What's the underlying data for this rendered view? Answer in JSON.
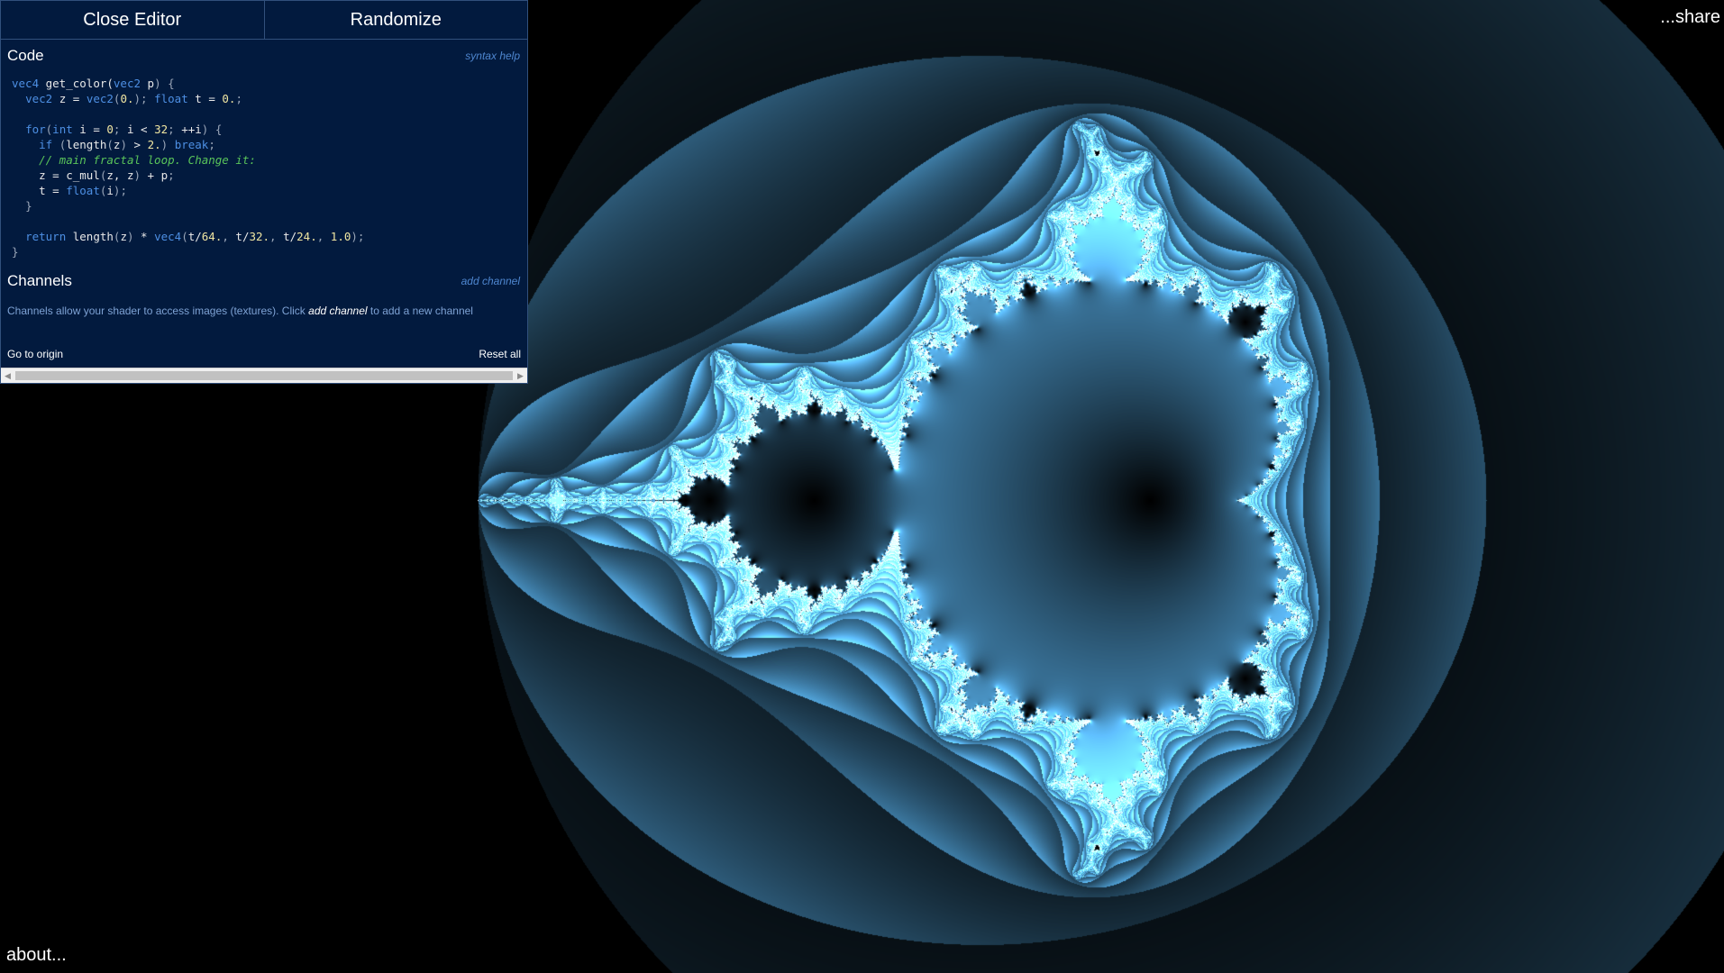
{
  "editor": {
    "close_label": "Close Editor",
    "randomize_label": "Randomize",
    "code_title": "Code",
    "syntax_help": "syntax help",
    "channels_title": "Channels",
    "add_channel": "add channel",
    "channels_desc_pre": "Channels allow your shader to access images (textures). Click ",
    "channels_desc_link": "add channel",
    "channels_desc_post": " to add a new channel",
    "go_to_origin": "Go to origin",
    "reset_all": "Reset all"
  },
  "code_lines": [
    [
      [
        "kw",
        "vec4"
      ],
      [
        "tx",
        " get_color("
      ],
      [
        "kw",
        "vec2"
      ],
      [
        "tx",
        " p"
      ],
      [
        "pun",
        ") {"
      ]
    ],
    [
      [
        "tx",
        "  "
      ],
      [
        "kw",
        "vec2"
      ],
      [
        "tx",
        " z = "
      ],
      [
        "fn",
        "vec2"
      ],
      [
        "pun",
        "("
      ],
      [
        "num",
        "0."
      ],
      [
        "pun",
        ");"
      ],
      [
        "tx",
        " "
      ],
      [
        "kw",
        "float"
      ],
      [
        "tx",
        " t = "
      ],
      [
        "num",
        "0."
      ],
      [
        "pun",
        ";"
      ]
    ],
    [],
    [
      [
        "tx",
        "  "
      ],
      [
        "kw",
        "for"
      ],
      [
        "pun",
        "("
      ],
      [
        "kw",
        "int"
      ],
      [
        "tx",
        " i = "
      ],
      [
        "num",
        "0"
      ],
      [
        "pun",
        ";"
      ],
      [
        "tx",
        " i < "
      ],
      [
        "num",
        "32"
      ],
      [
        "pun",
        ";"
      ],
      [
        "tx",
        " ++i"
      ],
      [
        "pun",
        ") {"
      ]
    ],
    [
      [
        "tx",
        "    "
      ],
      [
        "kw",
        "if"
      ],
      [
        "tx",
        " "
      ],
      [
        "pun",
        "("
      ],
      [
        "tx",
        "length"
      ],
      [
        "pun",
        "("
      ],
      [
        "tx",
        "z"
      ],
      [
        "pun",
        ")"
      ],
      [
        "tx",
        " > "
      ],
      [
        "num",
        "2."
      ],
      [
        "pun",
        ")"
      ],
      [
        "tx",
        " "
      ],
      [
        "kw",
        "break"
      ],
      [
        "pun",
        ";"
      ]
    ],
    [
      [
        "tx",
        "    "
      ],
      [
        "cm",
        "// main fractal loop. Change it:"
      ]
    ],
    [
      [
        "tx",
        "    z = c_mul"
      ],
      [
        "pun",
        "("
      ],
      [
        "tx",
        "z, z"
      ],
      [
        "pun",
        ")"
      ],
      [
        "tx",
        " + p"
      ],
      [
        "pun",
        ";"
      ]
    ],
    [
      [
        "tx",
        "    t = "
      ],
      [
        "fn",
        "float"
      ],
      [
        "pun",
        "("
      ],
      [
        "tx",
        "i"
      ],
      [
        "pun",
        ");"
      ]
    ],
    [
      [
        "tx",
        "  "
      ],
      [
        "pun",
        "}"
      ]
    ],
    [],
    [
      [
        "tx",
        "  "
      ],
      [
        "kw",
        "return"
      ],
      [
        "tx",
        " length"
      ],
      [
        "pun",
        "("
      ],
      [
        "tx",
        "z"
      ],
      [
        "pun",
        ")"
      ],
      [
        "tx",
        " * "
      ],
      [
        "fn",
        "vec4"
      ],
      [
        "pun",
        "("
      ],
      [
        "tx",
        "t/"
      ],
      [
        "num",
        "64."
      ],
      [
        "pun",
        ","
      ],
      [
        "tx",
        " t/"
      ],
      [
        "num",
        "32."
      ],
      [
        "pun",
        ","
      ],
      [
        "tx",
        " t/"
      ],
      [
        "num",
        "24."
      ],
      [
        "pun",
        ","
      ],
      [
        "tx",
        " "
      ],
      [
        "num",
        "1.0"
      ],
      [
        "pun",
        ");"
      ]
    ],
    [
      [
        "pun",
        "}"
      ]
    ]
  ],
  "overlay": {
    "share_label": "...share",
    "about_label": "about..."
  },
  "colors": {
    "panel_bg": "#021a3e",
    "accent": "#4e86cf",
    "fractal_tint": [
      64,
      32,
      24
    ]
  },
  "fractal": {
    "formula": "z = z*z + p",
    "max_iterations": 32,
    "escape_radius": 2
  }
}
